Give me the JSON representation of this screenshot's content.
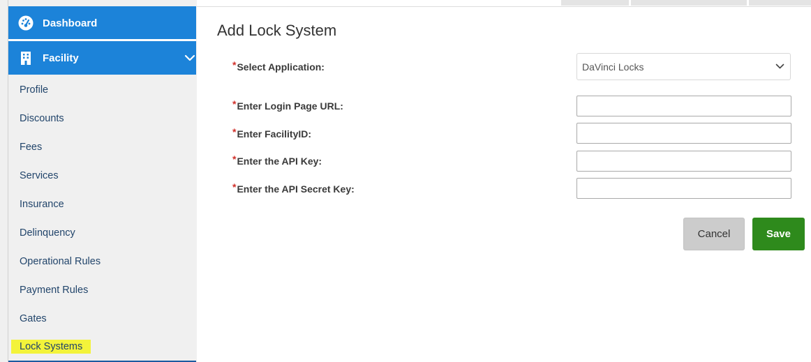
{
  "sidebar": {
    "dashboard_label": "Dashboard",
    "facility_label": "Facility",
    "items": [
      {
        "label": "Profile"
      },
      {
        "label": "Discounts"
      },
      {
        "label": "Fees"
      },
      {
        "label": "Services"
      },
      {
        "label": "Insurance"
      },
      {
        "label": "Delinquency"
      },
      {
        "label": "Operational Rules"
      },
      {
        "label": "Payment Rules"
      },
      {
        "label": "Gates"
      },
      {
        "label": "Lock Systems"
      }
    ],
    "highlighted_item": "Lock Systems"
  },
  "main": {
    "title": "Add Lock System",
    "fields": {
      "application": {
        "label": "Select Application:",
        "value": "DaVinci Locks"
      },
      "login_url": {
        "label": "Enter Login Page URL:",
        "value": ""
      },
      "facility_id": {
        "label": "Enter FacilityID:",
        "value": ""
      },
      "api_key": {
        "label": "Enter the API Key:",
        "value": ""
      },
      "api_secret": {
        "label": "Enter the API Secret Key:",
        "value": ""
      }
    },
    "required_marker": "*",
    "buttons": {
      "cancel": "Cancel",
      "save": "Save"
    }
  },
  "colors": {
    "nav_blue": "#1c83d9",
    "save_green": "#2e8a1c",
    "required_red": "#d0302a",
    "highlight_yellow": "#f3f33a",
    "nav_text": "#22456b"
  },
  "icons": {
    "dashboard": "speedometer-icon",
    "facility": "building-icon",
    "expand": "chevron-down-icon",
    "select": "chevron-down-icon"
  }
}
